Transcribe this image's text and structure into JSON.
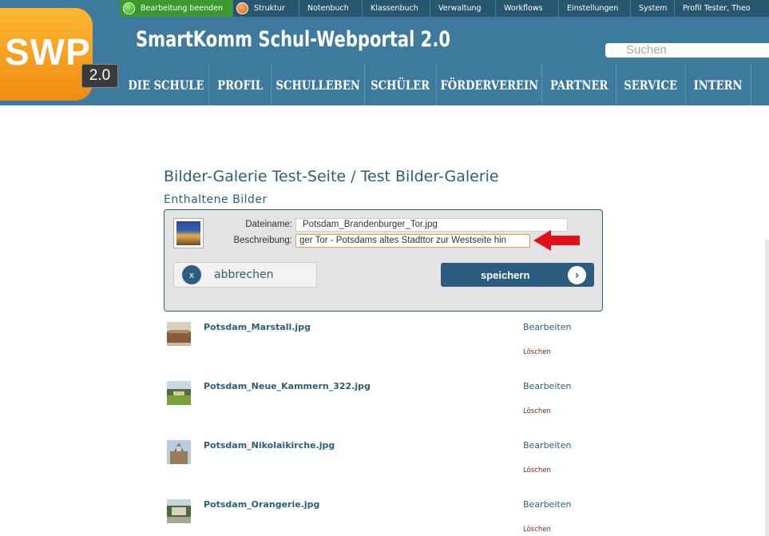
{
  "topbar": {
    "items": [
      {
        "label": "Bearbeitung beenden",
        "icon": "green-circle-icon"
      },
      {
        "label": "Struktur",
        "icon": "orange-circle-icon"
      },
      {
        "label": "Notenbuch"
      },
      {
        "label": "Klassenbuch"
      },
      {
        "label": "Verwaltung"
      },
      {
        "label": "Workflows"
      },
      {
        "label": "Einstellungen"
      },
      {
        "label": "System"
      },
      {
        "label": "Profil Tester, Theo"
      }
    ]
  },
  "logo": {
    "text": "SWP",
    "version": "2.0"
  },
  "site_title": "SmartKomm Schul-Webportal 2.0",
  "search": {
    "placeholder": "Suchen"
  },
  "mainnav": {
    "items": [
      "DIE SCHULE",
      "PROFIL",
      "SCHULLEBEN",
      "SCHÜLER",
      "FÖRDERVEREIN",
      "PARTNER",
      "SERVICE",
      "INTERN"
    ]
  },
  "page": {
    "title": "Bilder-Galerie Test-Seite / Test Bilder-Galerie",
    "section_title": "Enthaltene Bilder"
  },
  "editor": {
    "filename_label": "Dateiname:",
    "filename_value": "Potsdam_Brandenburger_Tor.jpg",
    "description_label": "Beschreibung:",
    "description_value": "ger Tor - Potsdams altes Stadttor zur Westseite hin",
    "cancel_label": "abbrechen",
    "cancel_icon": "x",
    "save_label": "speichern",
    "save_icon": "›"
  },
  "images": [
    {
      "name": "Potsdam_Marstall.jpg",
      "edit": "Bearbeiten",
      "delete": "Löschen"
    },
    {
      "name": "Potsdam_Neue_Kammern_322.jpg",
      "edit": "Bearbeiten",
      "delete": "Löschen"
    },
    {
      "name": "Potsdam_Nikolaikirche.jpg",
      "edit": "Bearbeiten",
      "delete": "Löschen"
    },
    {
      "name": "Potsdam_Orangerie.jpg",
      "edit": "Bearbeiten",
      "delete": "Löschen"
    }
  ],
  "colors": {
    "header_blue": "#3d7a9e",
    "topbar_dark": "#27566f",
    "accent_text": "#2b5e7e",
    "logo_orange": "#f5a21c",
    "active_green": "#3a9a2e",
    "delete_red": "#8b1a1a",
    "arrow_red": "#e3101a"
  }
}
